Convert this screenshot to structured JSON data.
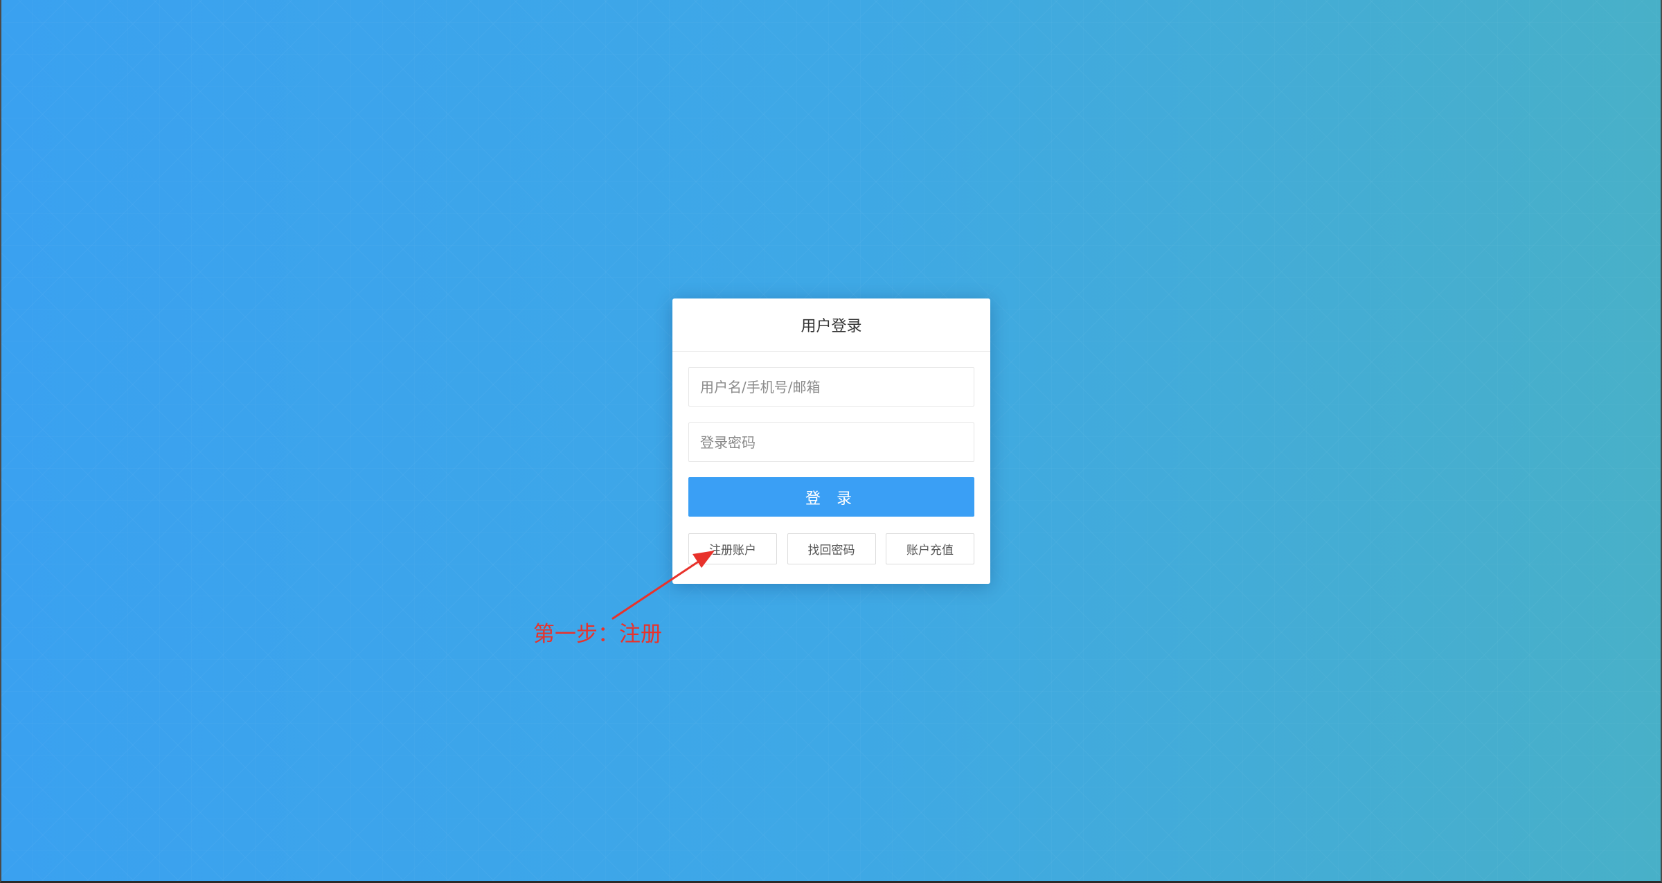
{
  "login": {
    "title": "用户登录",
    "username_placeholder": "用户名/手机号/邮箱",
    "password_placeholder": "登录密码",
    "login_label": "登 录",
    "links": {
      "register": "注册账户",
      "recover_password": "找回密码",
      "recharge": "账户充值"
    }
  },
  "annotation": {
    "text": "第一步：注册",
    "color": "#e8322b"
  },
  "colors": {
    "primary_button": "#3a9ff5",
    "background_start": "#3aa1f0",
    "background_end": "#48b0c8"
  },
  "icons": {
    "annotation": "red-arrow-icon"
  }
}
